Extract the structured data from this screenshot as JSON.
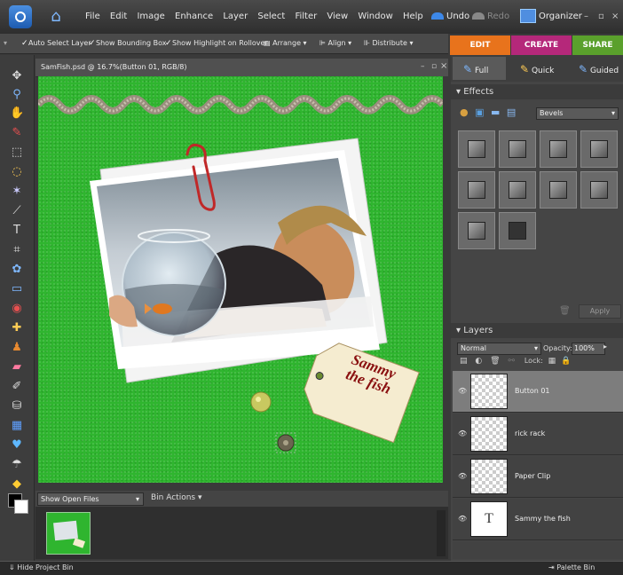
{
  "menubar": {
    "items": [
      "File",
      "Edit",
      "Image",
      "Enhance",
      "Layer",
      "Select",
      "Filter",
      "View",
      "Window",
      "Help"
    ],
    "undo": "Undo",
    "redo": "Redo",
    "organizer": "Organizer"
  },
  "options": {
    "auto_select": "Auto Select Layer",
    "bounding_box": "Show Bounding Box",
    "highlight": "Show Highlight on Rollover",
    "arrange": "Arrange",
    "align": "Align",
    "distribute": "Distribute"
  },
  "modes": {
    "edit": "EDIT",
    "create": "CREATE",
    "share": "SHARE"
  },
  "subtabs": {
    "full": "Full",
    "quick": "Quick",
    "guided": "Guided"
  },
  "document": {
    "title": "SamFish.psd @ 16.7%(Button 01, RGB/8)"
  },
  "tag": {
    "line1": "Sammy",
    "line2": "the fish"
  },
  "effects": {
    "header": "Effects",
    "category": "Bevels",
    "apply": "Apply"
  },
  "layers": {
    "header": "Layers",
    "blend_mode": "Normal",
    "opacity_label": "Opacity:",
    "opacity_value": "100%",
    "lock_label": "Lock:",
    "items": [
      {
        "name": "Button 01"
      },
      {
        "name": "rick rack"
      },
      {
        "name": "Paper Clip"
      },
      {
        "name": "Sammy the fish",
        "thumb": "T"
      }
    ]
  },
  "bin": {
    "show": "Show Open Files",
    "actions": "Bin Actions"
  },
  "status": {
    "hide_bin": "Hide Project Bin",
    "palette_bin": "Palette Bin"
  },
  "colors": {
    "canvas": "#2fb52f",
    "edit_tab": "#e8731c",
    "create_tab": "#b5287a",
    "share_tab": "#5aa02c",
    "tag_text": "#8a1010"
  }
}
